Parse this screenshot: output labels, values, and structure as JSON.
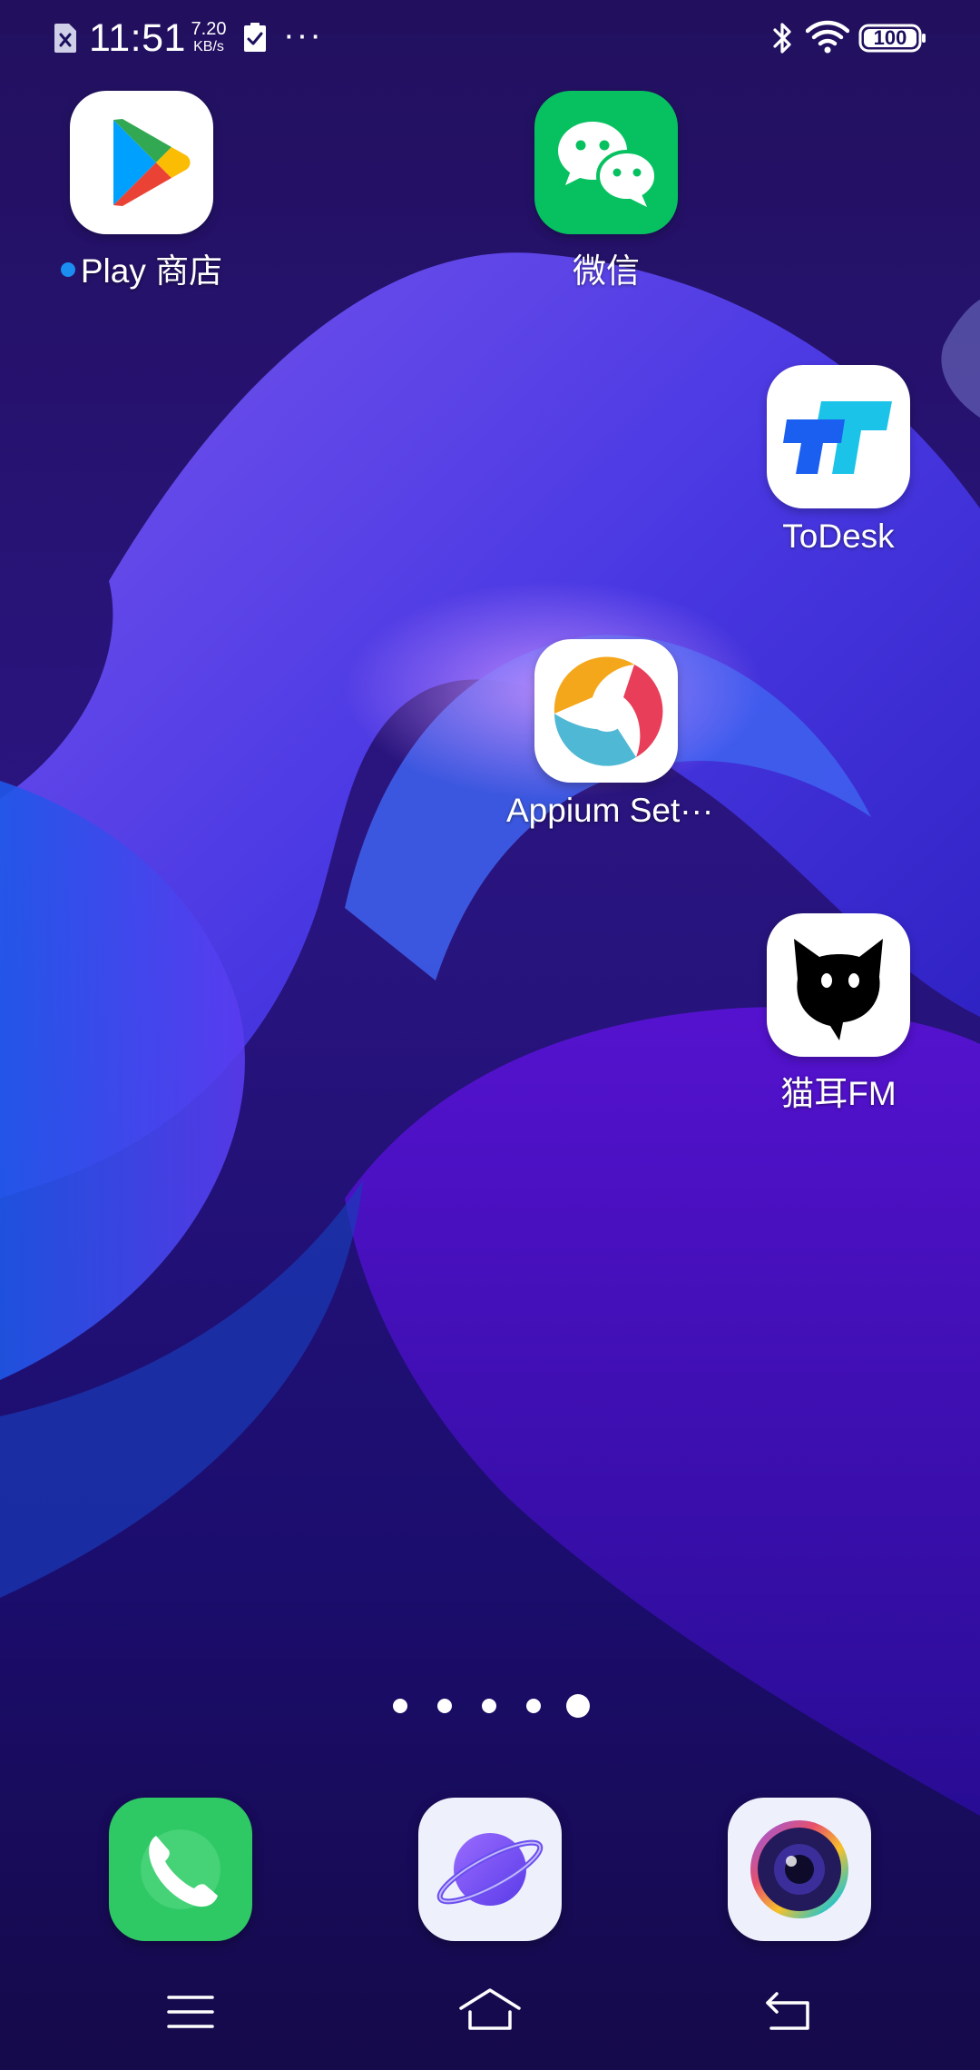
{
  "status_bar": {
    "time": "11:51",
    "net_speed_value": "7.20",
    "net_speed_unit": "KB/s",
    "more": "···",
    "battery": "100",
    "icons": [
      "sim-off-icon",
      "clipboard-check-icon",
      "bluetooth-icon",
      "wifi-icon",
      "battery-icon"
    ]
  },
  "home": {
    "apps": [
      {
        "label": "Play 商店",
        "icon": "google-play-icon",
        "has_new_dot": true
      },
      {
        "label": "微信",
        "icon": "wechat-icon"
      },
      {
        "label": "ToDesk",
        "icon": "todesk-icon"
      },
      {
        "label": "Appium Set···",
        "icon": "appium-settings-icon"
      },
      {
        "label": "猫耳FM",
        "icon": "maoer-fm-icon"
      }
    ],
    "page_indicator": {
      "count": 5,
      "current": 5
    }
  },
  "dock": {
    "apps": [
      {
        "name": "phone",
        "icon": "phone-icon"
      },
      {
        "name": "browser",
        "icon": "planet-browser-icon"
      },
      {
        "name": "camera",
        "icon": "camera-icon"
      }
    ]
  },
  "nav_bar": {
    "buttons": [
      "menu-icon",
      "home-icon",
      "back-icon"
    ]
  },
  "colors": {
    "wechat_green": "#07c160",
    "phone_green": "#34c759",
    "accent_blue": "#1b8ef2",
    "wallpaper_base": "#1a0f5c"
  }
}
